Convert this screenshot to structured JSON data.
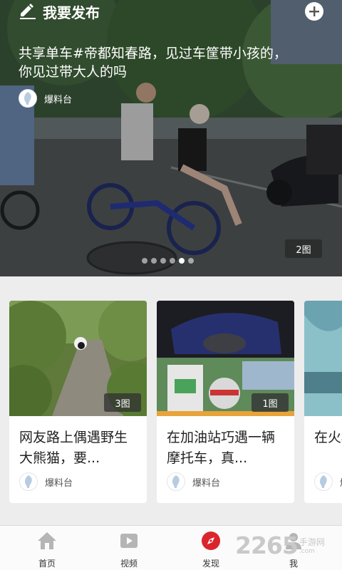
{
  "header": {
    "publish_label": "我要发布",
    "add_button": "plus-icon"
  },
  "hero": {
    "title": "共享单车#帝都知春路，见过车筐带小孩的，你见过带大人的吗",
    "source": "爆料台",
    "image_count": "2图",
    "carousel": {
      "total": 6,
      "active": 5
    }
  },
  "cards": [
    {
      "title": "网友路上偶遇野生大熊猫，要...",
      "source": "爆料台",
      "image_count": "3图"
    },
    {
      "title": "在加油站巧遇一辆摩托车，真...",
      "source": "爆料台",
      "image_count": "1图"
    },
    {
      "title": "在火种情",
      "source": "爆",
      "image_count": ""
    }
  ],
  "tabbar": {
    "items": [
      {
        "label": "首页",
        "icon": "home-icon"
      },
      {
        "label": "视频",
        "icon": "video-icon"
      },
      {
        "label": "发现",
        "icon": "compass-icon",
        "active_color": "#d9262c"
      },
      {
        "label": "我",
        "icon": "person-icon"
      }
    ]
  },
  "watermark": {
    "number": "2265",
    "zh": "手游网",
    "en": ".com"
  }
}
